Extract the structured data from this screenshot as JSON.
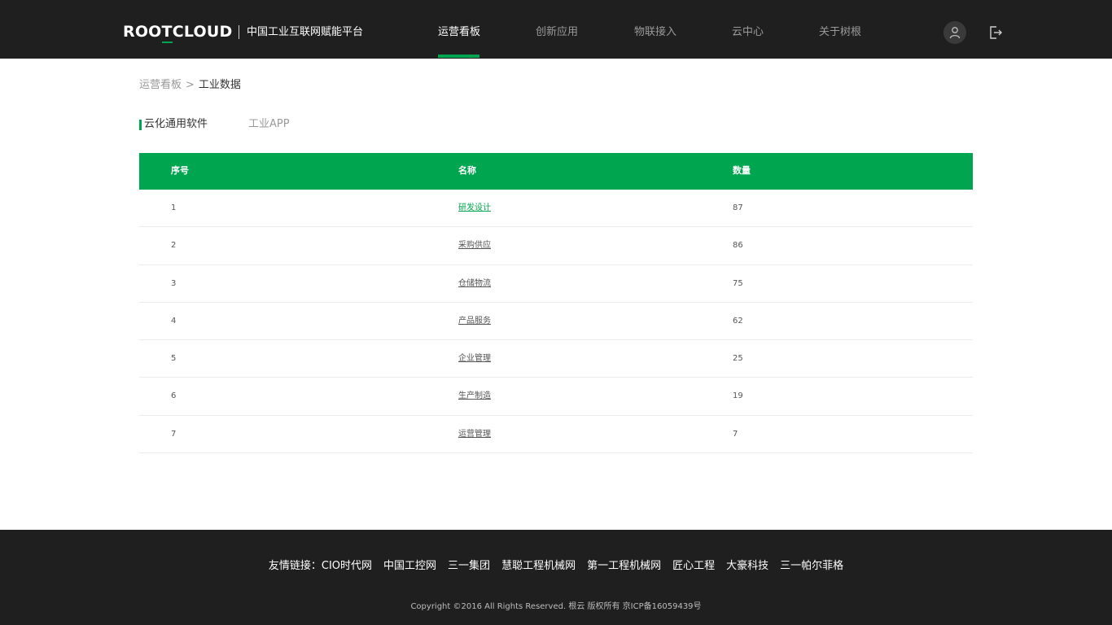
{
  "header": {
    "logo_pre": "ROO",
    "logo_t": "T",
    "logo_post": "CLOUD",
    "platform_name": "中国工业互联网赋能平台",
    "nav": [
      {
        "label": "运营看板",
        "active": true
      },
      {
        "label": "创新应用",
        "active": false
      },
      {
        "label": "物联接入",
        "active": false
      },
      {
        "label": "云中心",
        "active": false
      },
      {
        "label": "关于树根",
        "active": false
      }
    ],
    "user_icon": "user-icon",
    "logout_icon": "logout-icon"
  },
  "breadcrumb": {
    "parent": "运营看板",
    "separator": ">",
    "current": "工业数据"
  },
  "tabs": [
    {
      "label": "云化通用软件",
      "active": true
    },
    {
      "label": "工业APP",
      "active": false
    }
  ],
  "table": {
    "headers": {
      "index": "序号",
      "name": "名称",
      "quantity": "数量"
    },
    "rows": [
      {
        "index": "1",
        "name": "研发设计",
        "quantity": "87"
      },
      {
        "index": "2",
        "name": "采购供应",
        "quantity": "86"
      },
      {
        "index": "3",
        "name": "仓储物流",
        "quantity": "75"
      },
      {
        "index": "4",
        "name": "产品服务",
        "quantity": "62"
      },
      {
        "index": "5",
        "name": "企业管理",
        "quantity": "25"
      },
      {
        "index": "6",
        "name": "生产制造",
        "quantity": "19"
      },
      {
        "index": "7",
        "name": "运营管理",
        "quantity": "7"
      }
    ]
  },
  "footer": {
    "links_label": "友情链接：",
    "links": [
      "CIO时代网",
      "中国工控网",
      "三一集团",
      "慧聪工程机械网",
      "第一工程机械网",
      "匠心工程",
      "大豪科技",
      "三一帕尔菲格"
    ],
    "copyright": "Copyright ©2016 All Rights Reserved. 根云 版权所有 京ICP备16059439号"
  },
  "colors": {
    "brand_green": "#00a54f",
    "header_bg": "#1f1f1f",
    "footer_bg": "#1f1f1f"
  }
}
